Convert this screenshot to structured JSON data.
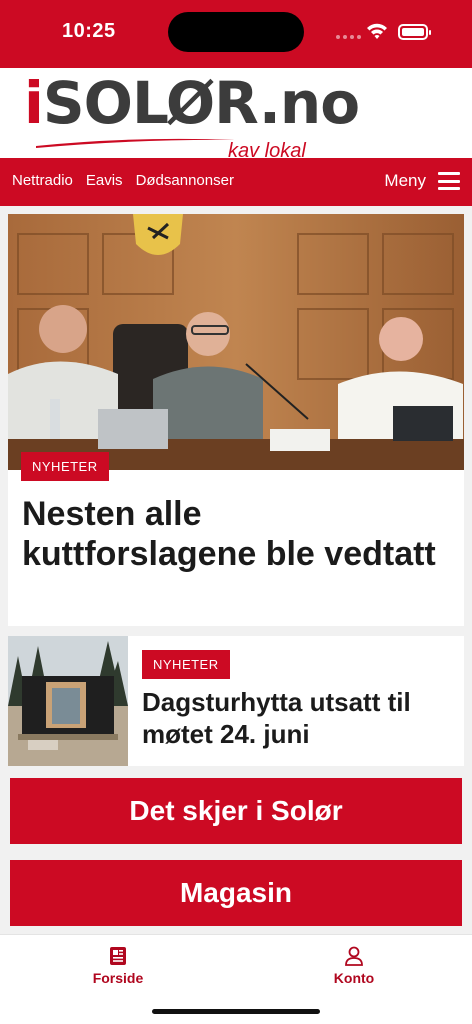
{
  "status_bar": {
    "time": "10:25"
  },
  "brand": {
    "logo_first": "i",
    "logo_rest": "SOLØR.no",
    "tagline": "kav lokal",
    "color": "#cc0a23"
  },
  "nav": {
    "links": [
      "Nettradio",
      "Eavis",
      "Dødsannonser"
    ],
    "menu_label": "Meny"
  },
  "articles": [
    {
      "category": "NYHETER",
      "title": "Nesten alle kuttforslagene ble vedtatt"
    },
    {
      "category": "NYHETER",
      "title": "Dagsturhytta utsatt til møtet 24. juni"
    }
  ],
  "sections": {
    "events": "Det skjer i Solør",
    "magazine": "Magasin"
  },
  "tabbar": {
    "home": "Forside",
    "account": "Konto"
  }
}
